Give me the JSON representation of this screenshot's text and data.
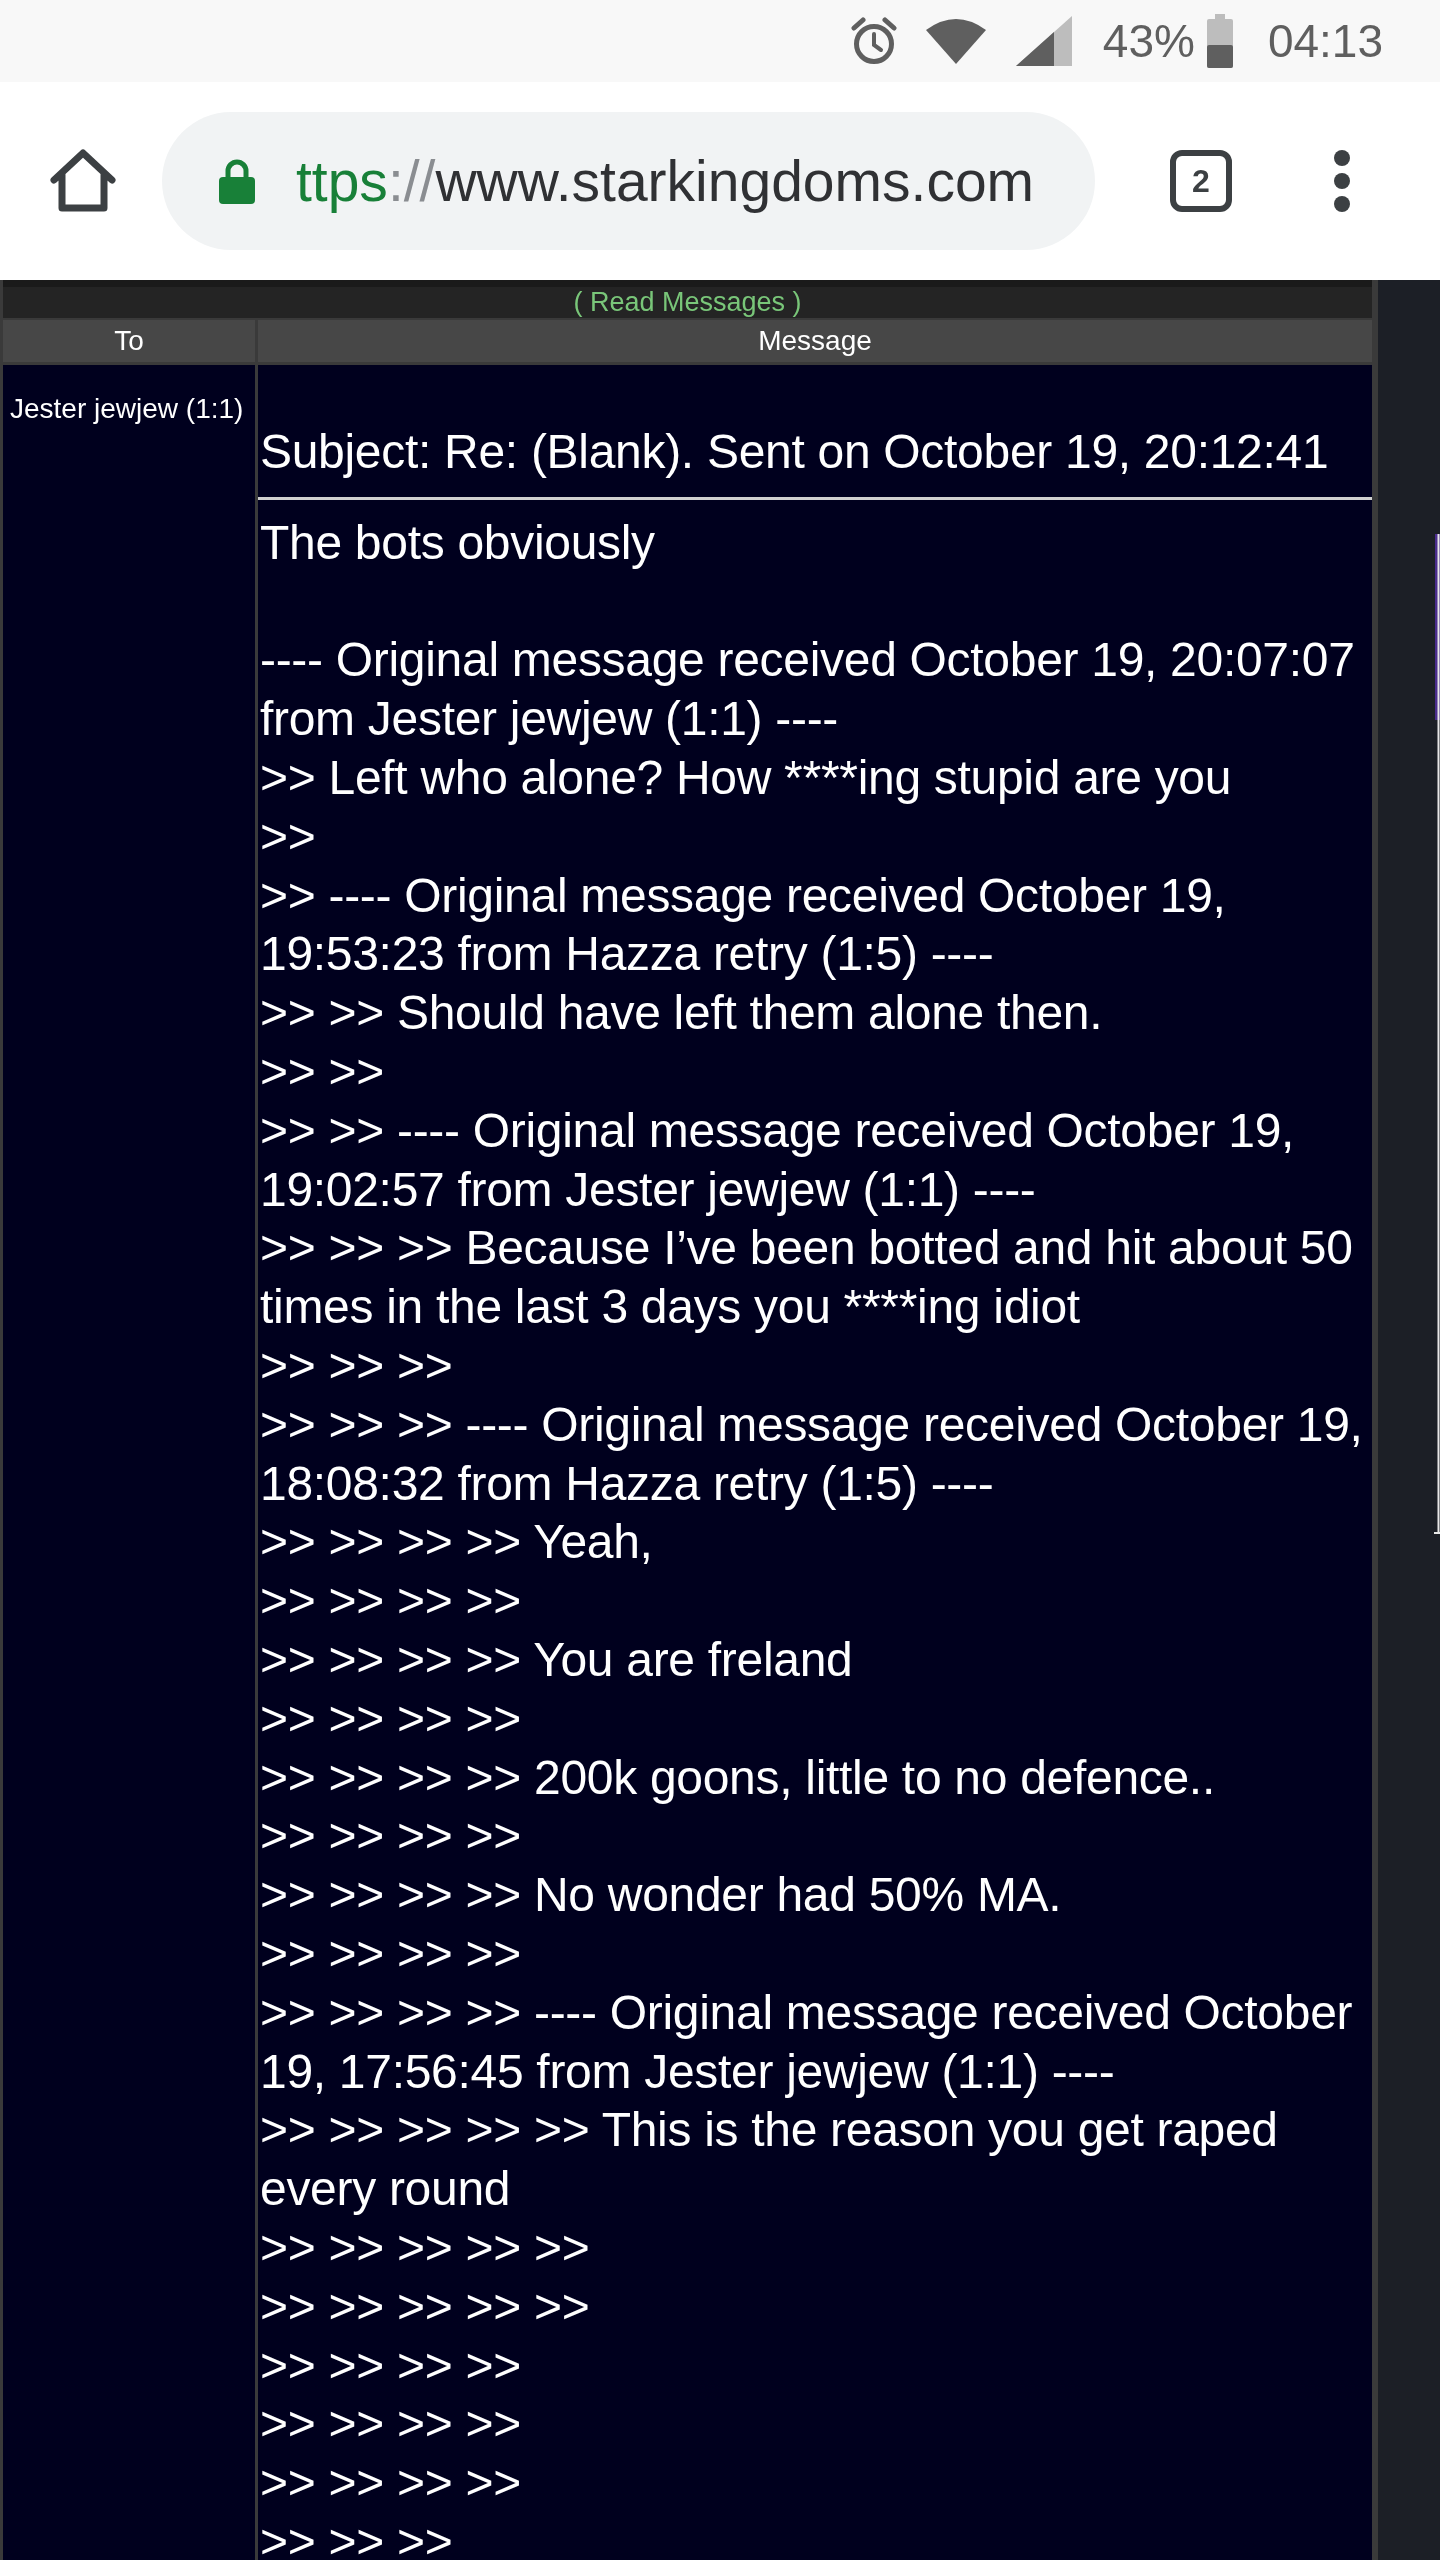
{
  "status_bar": {
    "battery": "43%",
    "time": "04:13"
  },
  "browser": {
    "address": {
      "scheme": "ttps",
      "separator": "://",
      "host": "www.starkingdoms.com"
    },
    "tab_count": "2"
  },
  "messages_panel": {
    "title": "( Read Messages )",
    "columns": [
      "To",
      "Message"
    ],
    "message": {
      "to": "Jester jewjew (1:1)",
      "subject": "Subject: Re: (Blank). Sent on October 19, 20:12:41",
      "paragraphs": [
        [
          "The bots obviously"
        ],
        [
          "---- Original message received October 19, 20:07:07 from Jester jewjew (1:1) ----",
          ">> Left who alone? How ****ing stupid are you",
          ">>",
          ">> ---- Original message received October 19, 19:53:23 from Hazza retry (1:5) ----",
          ">> >> Should have left them alone then.",
          ">> >>",
          ">> >> ---- Original message received October 19, 19:02:57 from Jester jewjew (1:1) ----",
          ">> >> >> Because I’ve been botted and hit about 50 times in the last 3 days you ****ing idiot",
          ">> >> >>",
          ">> >> >> ---- Original message received October 19, 18:08:32 from Hazza retry (1:5) ----",
          ">> >> >> >> Yeah,",
          ">> >> >> >>",
          ">> >> >> >> You are freland",
          ">> >> >> >>",
          ">> >> >> >> 200k goons, little to no defence..",
          ">> >> >> >>",
          ">> >> >> >> No wonder had 50% MA.",
          ">> >> >> >>",
          ">> >> >> >> ---- Original message received October 19, 17:56:45 from Jester jewjew (1:1) ----",
          ">> >> >> >> >> This is the reason you get raped every round",
          ">> >> >> >> >>",
          ">> >> >> >> >>",
          ">> >> >> >>",
          ">> >> >> >>",
          ">> >> >> >>",
          ">> >> >>"
        ]
      ]
    }
  }
}
